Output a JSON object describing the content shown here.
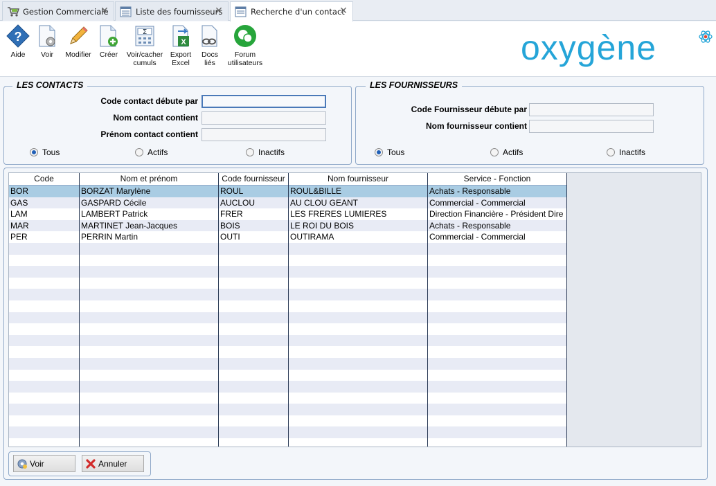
{
  "tabs": [
    {
      "label": "Gestion Commerciale",
      "active": false
    },
    {
      "label": "Liste des fournisseurs",
      "active": false
    },
    {
      "label": "Recherche d'un contact",
      "active": true
    }
  ],
  "toolbar": {
    "aide": "Aide",
    "voir": "Voir",
    "modifier": "Modifier",
    "creer": "Créer",
    "cumuls_line1": "Voir/cacher",
    "cumuls_line2": "cumuls",
    "export_line1": "Export",
    "export_line2": "Excel",
    "docs_line1": "Docs",
    "docs_line2": "liés",
    "forum_line1": "Forum",
    "forum_line2": "utilisateurs"
  },
  "logo": {
    "text": "oxygène",
    "color": "#25a5d8"
  },
  "contacts": {
    "title": "LES CONTACTS",
    "code_label": "Code contact débute par",
    "code_value": "",
    "nom_label": "Nom contact contient",
    "nom_value": "",
    "prenom_label": "Prénom contact contient",
    "prenom_value": "",
    "radio_tous": "Tous",
    "radio_actifs": "Actifs",
    "radio_inactifs": "Inactifs",
    "selected": "Tous"
  },
  "fournisseurs": {
    "title": "LES FOURNISSEURS",
    "code_label": "Code Fournisseur débute par",
    "code_value": "",
    "nom_label": "Nom fournisseur contient",
    "nom_value": "",
    "radio_tous": "Tous",
    "radio_actifs": "Actifs",
    "radio_inactifs": "Inactifs",
    "selected": "Tous"
  },
  "grid": {
    "headers": [
      "Code",
      "Nom et prénom",
      "Code fournisseur",
      "Nom fournisseur",
      "Service - Fonction"
    ],
    "rows": [
      [
        "BOR",
        "BORZAT Marylène",
        "ROUL",
        "ROUL&BILLE",
        "Achats - Responsable"
      ],
      [
        "GAS",
        "GASPARD Cécile",
        "AUCLOU",
        "AU CLOU GEANT",
        "Commercial - Commercial"
      ],
      [
        "LAM",
        "LAMBERT Patrick",
        "FRER",
        "LES FRERES LUMIERES",
        "Direction Financière - Président Dire"
      ],
      [
        "MAR",
        "MARTINET Jean-Jacques",
        "BOIS",
        "LE ROI DU BOIS",
        "Achats - Responsable"
      ],
      [
        "PER",
        "PERRIN Martin",
        "OUTI",
        "OUTIRAMA",
        "Commercial - Commercial"
      ]
    ],
    "selected_row": 0
  },
  "buttons": {
    "voir": "Voir",
    "annuler": "Annuler"
  },
  "colors": {
    "accent": "#1f5fb7",
    "selection": "#a9cce3",
    "border": "#8fa8c8"
  }
}
